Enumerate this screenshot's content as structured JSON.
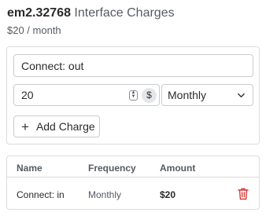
{
  "header": {
    "interface_id": "em2.32768",
    "label": "Interface Charges",
    "price": "$20 / month"
  },
  "form": {
    "description_value": "Connect: out",
    "amount_value": "20",
    "currency_symbol": "$",
    "frequency_selected": "Monthly",
    "add_button_label": "Add Charge"
  },
  "table": {
    "headers": [
      "Name",
      "Frequency",
      "Amount"
    ],
    "rows": [
      {
        "name": "Connect: in",
        "frequency": "Monthly",
        "amount": "$20"
      }
    ]
  },
  "colors": {
    "delete_icon": "#d63a3a",
    "border": "#dcdcdc"
  }
}
